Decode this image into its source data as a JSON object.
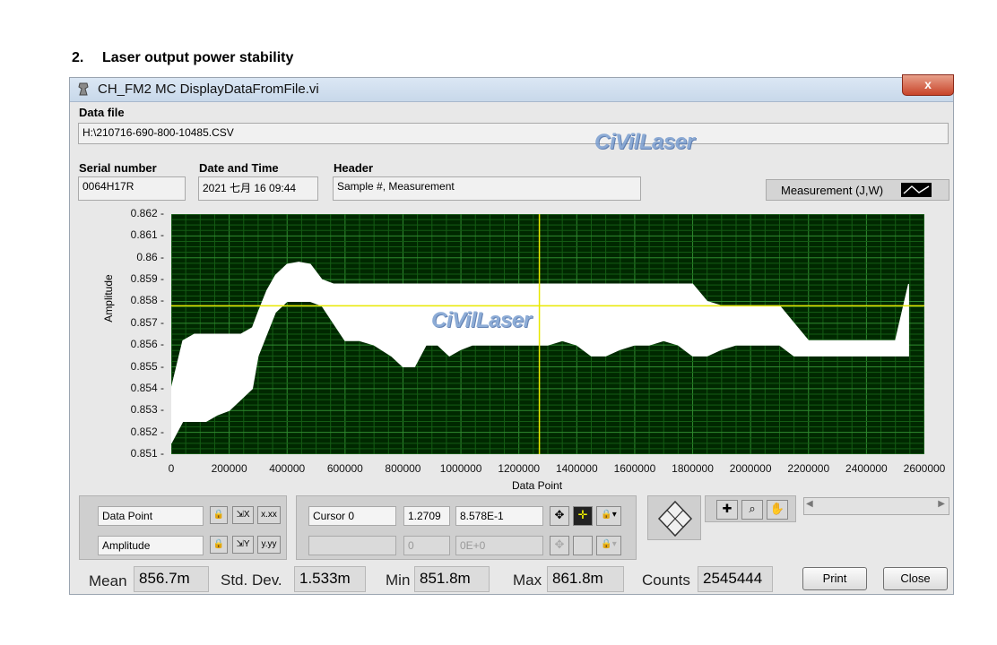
{
  "heading": {
    "number": "2.",
    "text": "Laser output power stability"
  },
  "window": {
    "title": "CH_FM2 MC DisplayDataFromFile.vi",
    "close_label": "x",
    "watermark": "CiVilLaser"
  },
  "data_file": {
    "label": "Data file",
    "value": "H:\\210716-690-800-10485.CSV"
  },
  "serial": {
    "label": "Serial number",
    "value": "0064H17R"
  },
  "datetime": {
    "label": "Date and Time",
    "value": "2021 七月 16 09:44"
  },
  "header": {
    "label": "Header",
    "value": "Sample #, Measurement"
  },
  "legend": {
    "label": "Measurement (J,W)"
  },
  "chart_data": {
    "type": "line",
    "xlabel": "Data Point",
    "ylabel": "Amplitude",
    "xlim": [
      0,
      2600000
    ],
    "ylim": [
      0.851,
      0.862
    ],
    "x_ticks": [
      "0",
      "200000",
      "400000",
      "600000",
      "800000",
      "1000000",
      "1200000",
      "1400000",
      "1600000",
      "1800000",
      "2000000",
      "2200000",
      "2400000",
      "2600000"
    ],
    "y_ticks": [
      "0.862",
      "0.861",
      "0.86",
      "0.859",
      "0.858",
      "0.857",
      "0.856",
      "0.855",
      "0.854",
      "0.853",
      "0.852",
      "0.851"
    ],
    "cursor": {
      "x": 1270900,
      "y": 0.8578
    },
    "series": [
      {
        "color": "#ffffff",
        "x": [
          0,
          40000,
          80000,
          120000,
          160000,
          200000,
          240000,
          280000,
          300000,
          330000,
          360000,
          400000,
          440000,
          480000,
          520000,
          560000,
          600000,
          650000,
          700000,
          760000,
          800000,
          840000,
          880000,
          920000,
          960000,
          1000000,
          1040000,
          1080000,
          1120000,
          1160000,
          1200000,
          1250000,
          1300000,
          1350000,
          1400000,
          1450000,
          1500000,
          1550000,
          1600000,
          1650000,
          1700000,
          1750000,
          1800000,
          1850000,
          1900000,
          1950000,
          2000000,
          2050000,
          2100000,
          2150000,
          2200000,
          2250000,
          2300000,
          2350000,
          2400000,
          2450000,
          2500000,
          2545444
        ],
        "min": [
          0.8515,
          0.8525,
          0.8525,
          0.8525,
          0.8528,
          0.853,
          0.8535,
          0.854,
          0.8555,
          0.8565,
          0.8575,
          0.858,
          0.858,
          0.858,
          0.8578,
          0.857,
          0.8562,
          0.8562,
          0.856,
          0.8555,
          0.855,
          0.855,
          0.856,
          0.856,
          0.8555,
          0.8558,
          0.856,
          0.856,
          0.856,
          0.856,
          0.856,
          0.856,
          0.856,
          0.8562,
          0.856,
          0.8555,
          0.8555,
          0.8558,
          0.856,
          0.856,
          0.8562,
          0.856,
          0.8555,
          0.8555,
          0.8558,
          0.856,
          0.856,
          0.856,
          0.856,
          0.8555,
          0.8555,
          0.8555,
          0.8555,
          0.8555,
          0.8555,
          0.8555,
          0.8555,
          0.8555
        ],
        "max": [
          0.854,
          0.8562,
          0.8565,
          0.8565,
          0.8565,
          0.8565,
          0.8565,
          0.8568,
          0.8575,
          0.8585,
          0.8592,
          0.8597,
          0.8598,
          0.8597,
          0.859,
          0.8588,
          0.8588,
          0.8588,
          0.8588,
          0.8588,
          0.8588,
          0.8588,
          0.8588,
          0.8588,
          0.8588,
          0.8588,
          0.8588,
          0.8588,
          0.8588,
          0.8588,
          0.8588,
          0.8588,
          0.8588,
          0.8588,
          0.8588,
          0.8588,
          0.8588,
          0.8588,
          0.8588,
          0.8588,
          0.8588,
          0.8588,
          0.8588,
          0.858,
          0.8578,
          0.8578,
          0.8578,
          0.8578,
          0.8578,
          0.857,
          0.8562,
          0.8562,
          0.8562,
          0.8562,
          0.8562,
          0.8562,
          0.8562,
          0.8588
        ]
      }
    ]
  },
  "cursor_panel": {
    "x_name": "Data Point",
    "y_name": "Amplitude",
    "cursor_name": "Cursor 0",
    "cursor_x": "1.2709",
    "cursor_y": "8.578E-1",
    "blank_x": "0",
    "blank_y": "0E+0"
  },
  "stats": {
    "mean_label": "Mean",
    "mean_value": "856.7m",
    "std_label": "Std. Dev.",
    "std_value": "1.533m",
    "min_label": "Min",
    "min_value": "851.8m",
    "max_label": "Max",
    "max_value": "861.8m",
    "counts_label": "Counts",
    "counts_value": "2545444"
  },
  "buttons": {
    "print": "Print",
    "close": "Close"
  }
}
